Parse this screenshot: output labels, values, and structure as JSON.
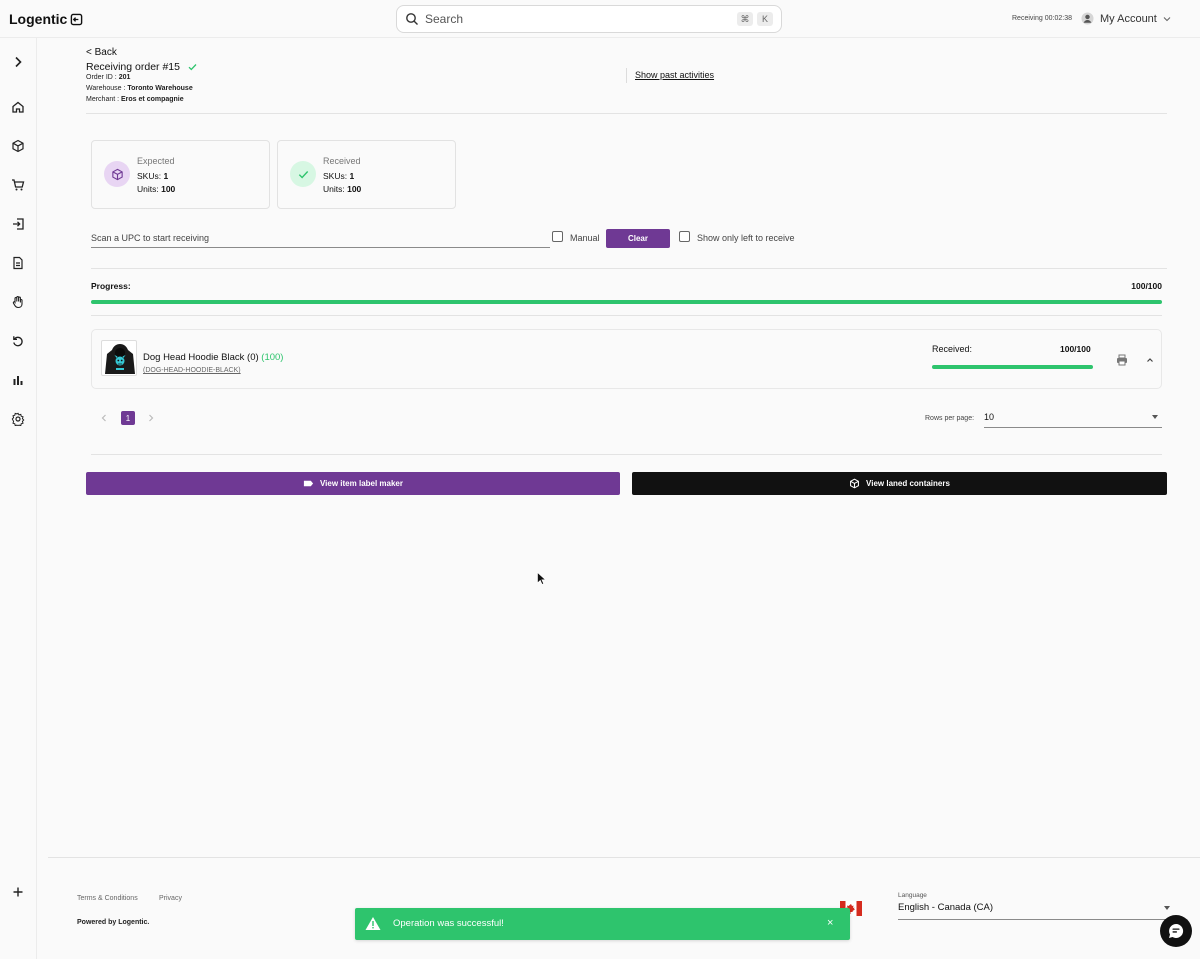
{
  "app": {
    "logo_text": "Logentic"
  },
  "search": {
    "placeholder": "Search",
    "kbd1": "⌘",
    "kbd2": "K"
  },
  "topbar": {
    "receiving_label": "Receiving",
    "timer": "00:02:38",
    "account_label": "My Account"
  },
  "header": {
    "back": "< Back",
    "title": "Receiving order #15",
    "order_id_label": "Order ID : ",
    "order_id": "201",
    "warehouse_label": "Warehouse : ",
    "warehouse": "Toronto Warehouse",
    "merchant_label": "Merchant : ",
    "merchant": "Eros et compagnie",
    "past_activities": "Show past activities"
  },
  "cards": {
    "expected": {
      "label": "Expected",
      "skus_label": "SKUs: ",
      "skus": "1",
      "units_label": "Units: ",
      "units": "100"
    },
    "received": {
      "label": "Received",
      "skus_label": "SKUs: ",
      "skus": "1",
      "units_label": "Units: ",
      "units": "100"
    }
  },
  "scan": {
    "placeholder": "Scan a UPC to start receiving",
    "manual_label": "Manual",
    "clear_label": "Clear",
    "show_only_label": "Show only left to receive"
  },
  "progress": {
    "label": "Progress:",
    "value_text": "100/100",
    "fraction": 1.0
  },
  "item": {
    "name": "Dog Head Hoodie Black (0)",
    "qty": "(100)",
    "sku": "(DOG-HEAD-HOODIE-BLACK)",
    "received_label": "Received:",
    "received_value": "100/100",
    "received_fraction": 1.0
  },
  "pagination": {
    "current_page": "1",
    "rows_label": "Rows per page:",
    "rows_value": "10"
  },
  "actions": {
    "label_maker": "View item label maker",
    "containers": "View laned containers"
  },
  "footer": {
    "terms": "Terms & Conditions",
    "privacy": "Privacy",
    "powered": "Powered by Logentic.",
    "language_label": "Language",
    "language_value": "English - Canada (CA)"
  },
  "toast": {
    "message": "Operation was successful!",
    "close": "×"
  },
  "colors": {
    "accent": "#6f3994",
    "success": "#2ec46d",
    "dark": "#111111"
  }
}
